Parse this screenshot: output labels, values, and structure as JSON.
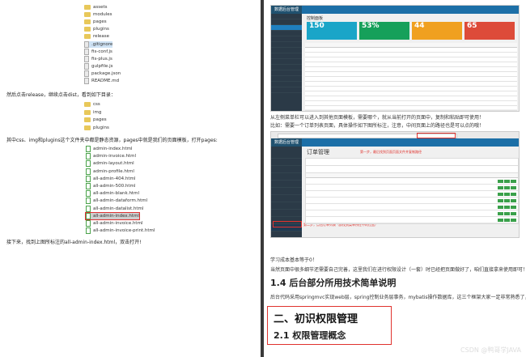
{
  "left": {
    "tree_top": [
      {
        "name": "assets",
        "type": "folder"
      },
      {
        "name": "modules",
        "type": "folder"
      },
      {
        "name": "pages",
        "type": "folder"
      },
      {
        "name": "plugins",
        "type": "folder"
      },
      {
        "name": "release",
        "type": "folder"
      },
      {
        "name": ".gitignore",
        "type": "file",
        "selected": true
      },
      {
        "name": "fis-conf.js",
        "type": "file"
      },
      {
        "name": "fis-plus.js",
        "type": "file"
      },
      {
        "name": "gulpfile.js",
        "type": "file"
      },
      {
        "name": "package.json",
        "type": "file"
      },
      {
        "name": "README.md",
        "type": "file"
      }
    ],
    "text1": "然后点击release，继续点击dist，看到如下目录：",
    "tree_mid": [
      {
        "name": "css",
        "type": "folder"
      },
      {
        "name": "img",
        "type": "folder"
      },
      {
        "name": "pages",
        "type": "folder"
      },
      {
        "name": "plugins",
        "type": "folder"
      }
    ],
    "text2": "其中css、img和plugins这个文件夹中都是静态资源，pages中就是我们的页面模板，打开pages:",
    "tree_pages": [
      "admin-index.html",
      "admin-invoice.html",
      "admin-layout.html",
      "admin-profile.html",
      "all-admin-404.html",
      "all-admin-500.html",
      "all-admin-blank.html",
      "all-admin-dataform.html",
      "all-admin-datalist.html",
      "all-admin-index.html",
      "all-admin-invoice.html",
      "all-admin-invoice-print.html"
    ],
    "highlighted_page": "all-admin-index.html",
    "text3": "接下来，找到上图所标注的all-admin-index.html，双击打开!"
  },
  "right": {
    "shot1": {
      "brand": "数据后台管理",
      "page_title": "控制面板",
      "tiles": [
        {
          "value": "150",
          "color": "#1aa5c8"
        },
        {
          "value": "53%",
          "color": "#16a05a"
        },
        {
          "value": "44",
          "color": "#f0a020"
        },
        {
          "value": "65",
          "color": "#dd4b39"
        }
      ]
    },
    "para1": "从左侧菜单栏可以进入到其他页面模板，需要哪个，就从当前打开的页面中，复制和粘贴即可使用！",
    "para2": "比如：需要一个订单列表页面，具体操作如下图所标注，注意，中间页面上的路径也是可以点的哦！",
    "shot2": {
      "brand": "数据后台管理",
      "page_title": "订单管理",
      "annotation": "第一步，最后找到页面页面文件并复制路径",
      "annotation2": "第二步，点击订单列表（即找到菜单所在中的位置）"
    },
    "para3": "学习成本基本等于0！",
    "para4": "当然页面中很多细节还需要自己完善，这里我们在进行权限设计（一套）时已经把页面做好了，咱们直接拿来使用即可！",
    "h_14": "1.4 后台部分所用技术简单说明",
    "para5": "后台代码采用springmvc实现web层，spring控制业务层事务，mybatis操作数据库，这三个框架大家一定非常熟悉了，这里就不再赘述！",
    "h_2": "二、初识权限管理",
    "h_21": "2.1 权限管理概念",
    "watermark": "CSDN @鸭哥学JAVA"
  }
}
